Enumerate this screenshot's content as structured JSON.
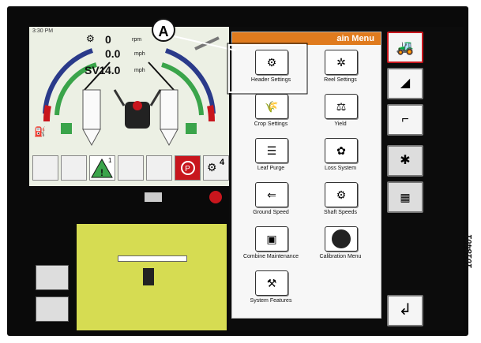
{
  "callout": {
    "letter": "A"
  },
  "figure_id": "1018401",
  "status": {
    "time": "3:30 PM",
    "engine_rpm": "0",
    "engine_unit": "rpm",
    "ground_speed": "0.0",
    "ground_unit": "mph",
    "sv_label": "SV1",
    "sv_value": "4.0",
    "sv_unit": "mph"
  },
  "warning_badge": "1",
  "gear_badge": "4",
  "menu": {
    "title": "ain Menu",
    "items": [
      {
        "label": "Header Settings",
        "icon": "header-icon"
      },
      {
        "label": "Reel Settings",
        "icon": "reel-icon"
      },
      {
        "label": "Crop Settings",
        "icon": "crop-icon"
      },
      {
        "label": "Yield",
        "icon": "yield-icon"
      },
      {
        "label": "Leaf Purge",
        "icon": "leaf-purge-icon"
      },
      {
        "label": "Loss System",
        "icon": "loss-icon"
      },
      {
        "label": "Ground Speed",
        "icon": "ground-speed-icon"
      },
      {
        "label": "Shaft Speeds",
        "icon": "shaft-icon"
      },
      {
        "label": "Combine Maintenance",
        "icon": "maintenance-icon"
      },
      {
        "label": "Calibration Menu",
        "icon": "calibration-icon"
      },
      {
        "label": "System Features",
        "icon": "features-icon"
      }
    ]
  },
  "colors": {
    "accent": "#e07b1e",
    "highlight": "#c8161d",
    "map": "#d6dc52"
  }
}
